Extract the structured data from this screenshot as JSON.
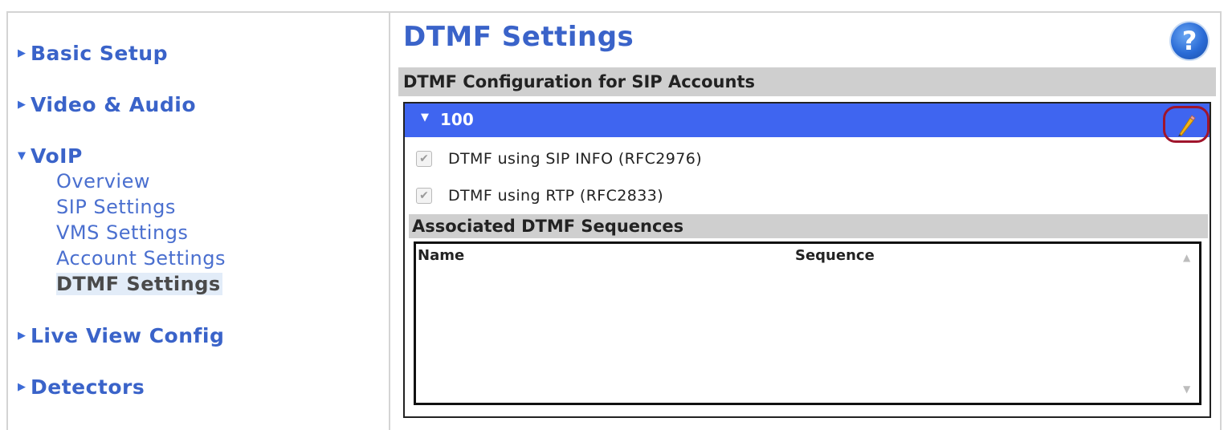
{
  "sidebar": {
    "basic_setup": "Basic Setup",
    "video_audio": "Video & Audio",
    "voip": "VoIP",
    "voip_items": {
      "overview": "Overview",
      "sip": "SIP Settings",
      "vms": "VMS Settings",
      "account": "Account Settings",
      "dtmf": "DTMF Settings"
    },
    "live_view": "Live View Config",
    "detectors": "Detectors"
  },
  "main": {
    "title": "DTMF Settings",
    "help_glyph": "?",
    "section_title": "DTMF Configuration for SIP Accounts",
    "account": {
      "number": "100",
      "sip_info_label": "DTMF using SIP INFO (RFC2976)",
      "sip_info_checked": true,
      "rtp_label": "DTMF using RTP (RFC2833)",
      "rtp_checked": true
    },
    "sequences": {
      "title": "Associated DTMF Sequences",
      "col_name": "Name",
      "col_sequence": "Sequence"
    }
  },
  "icons": {
    "collapsed": "triangle-right-icon",
    "expanded": "triangle-down-icon",
    "help": "help-icon",
    "edit": "pencil-icon",
    "check": "checkmark-icon"
  },
  "colors": {
    "link": "#3a63c9",
    "account_bar": "#3f65f0",
    "edit_highlight": "#a0152c",
    "section_bg": "#cfcfcf"
  }
}
